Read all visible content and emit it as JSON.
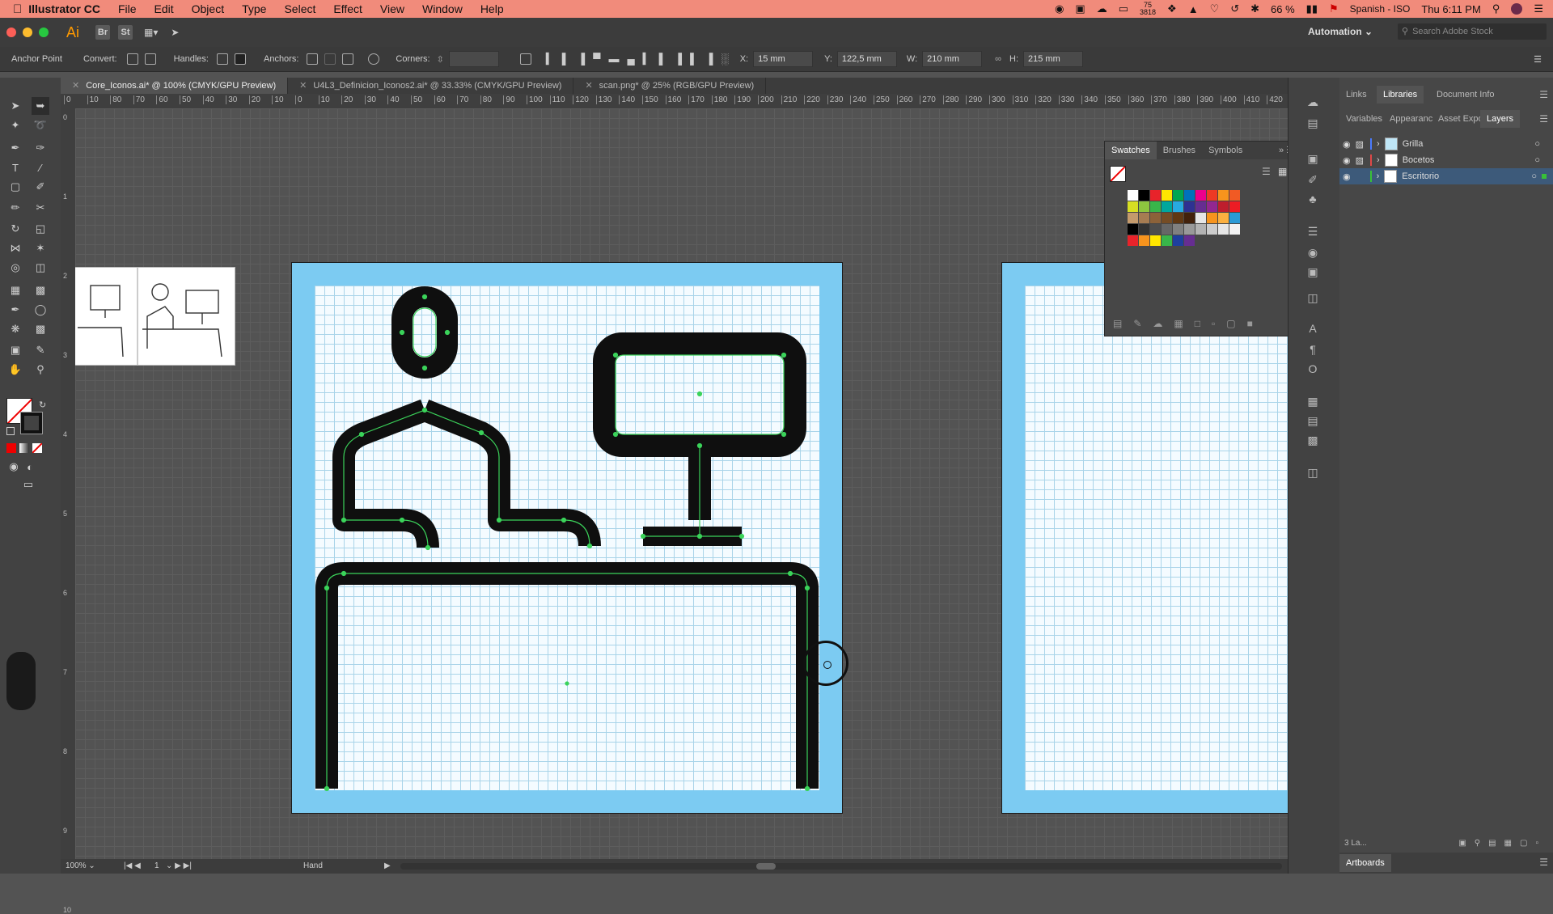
{
  "menubar": {
    "app_name": "Illustrator CC",
    "items": [
      "File",
      "Edit",
      "Object",
      "Type",
      "Select",
      "Effect",
      "View",
      "Window",
      "Help"
    ],
    "clock": "Thu 6:11 PM",
    "battery": "66 %",
    "input_source": "Spanish - ISO",
    "disk_count": "75",
    "disk_count2": "3818"
  },
  "appbar": {
    "logo": "Ai",
    "bridge": "Br",
    "stock": "St",
    "workspace": "Automation",
    "search_placeholder": "Search Adobe Stock"
  },
  "controlbar": {
    "tool_label": "Anchor Point",
    "convert_label": "Convert:",
    "handles_label": "Handles:",
    "anchors_label": "Anchors:",
    "corners_label": "Corners:",
    "x_label": "X:",
    "x_value": "15 mm",
    "y_label": "Y:",
    "y_value": "122,5 mm",
    "w_label": "W:",
    "w_value": "210 mm",
    "h_label": "H:",
    "h_value": "215 mm"
  },
  "tabs": [
    {
      "label": "Core_Iconos.ai* @ 100% (CMYK/GPU Preview)"
    },
    {
      "label": "U4L3_Definicion_Iconos2.ai* @ 33.33% (CMYK/GPU Preview)"
    },
    {
      "label": "scan.png* @ 25% (RGB/GPU Preview)"
    }
  ],
  "ruler_ticks": [
    "0",
    "10",
    "80",
    "70",
    "60",
    "50",
    "40",
    "30",
    "20",
    "10",
    "0",
    "10",
    "20",
    "30",
    "40",
    "50",
    "60",
    "70",
    "80",
    "90",
    "100",
    "110",
    "120",
    "130",
    "140",
    "150",
    "160",
    "170",
    "180",
    "190",
    "200",
    "210",
    "220",
    "230",
    "240",
    "250",
    "260",
    "270",
    "280",
    "290",
    "300",
    "310",
    "320",
    "330",
    "340",
    "350",
    "360",
    "370",
    "380",
    "390",
    "400",
    "410",
    "420"
  ],
  "vruler_ticks": [
    "0",
    "1",
    "2",
    "3",
    "4",
    "5",
    "6",
    "7",
    "8",
    "9",
    "10"
  ],
  "right_panel": {
    "top_tabs": [
      "Links",
      "Libraries",
      "Document Info"
    ],
    "sub_tabs": [
      "Variables",
      "Appearanc",
      "Asset Expo",
      "Layers"
    ],
    "layers": [
      {
        "name": "Grilla",
        "color": "#4a7bff"
      },
      {
        "name": "Bocetos",
        "color": "#e04848"
      },
      {
        "name": "Escritorio",
        "color": "#38c038"
      }
    ],
    "layer_count": "3 La...",
    "artboards_tab": "Artboards"
  },
  "swatches_panel": {
    "tabs": [
      "Swatches",
      "Brushes",
      "Symbols"
    ],
    "row1": [
      "#ffffff",
      "#000000",
      "#e8232a",
      "#ffe600",
      "#00a651",
      "#0072bc",
      "#ec008c",
      "#ee3a24",
      "#f7941d",
      "#f15a24"
    ],
    "row2": [
      "#d7df23",
      "#8dc63f",
      "#39b54a",
      "#00a79d",
      "#27aae1",
      "#2e3192",
      "#662d91",
      "#92278f",
      "#be1e2d",
      "#ed1c24"
    ],
    "row3": [
      "#c49a6c",
      "#a67c52",
      "#8c6239",
      "#754c24",
      "#603813",
      "#42210b",
      "#e6e6e6",
      "#f7941d",
      "#fbb040",
      "#2b9ad6"
    ],
    "grays": [
      "#000000",
      "#333333",
      "#4d4d4d",
      "#666666",
      "#808080",
      "#999999",
      "#b3b3b3",
      "#cccccc",
      "#e6e6e6",
      "#f2f2f2"
    ],
    "row5": [
      "#e8232a",
      "#f7941d",
      "#ffe600",
      "#39b54a",
      "#1e3f9e",
      "#662d91"
    ]
  },
  "statusbar": {
    "zoom": "100%",
    "page": "1",
    "tool_name": "Hand"
  }
}
